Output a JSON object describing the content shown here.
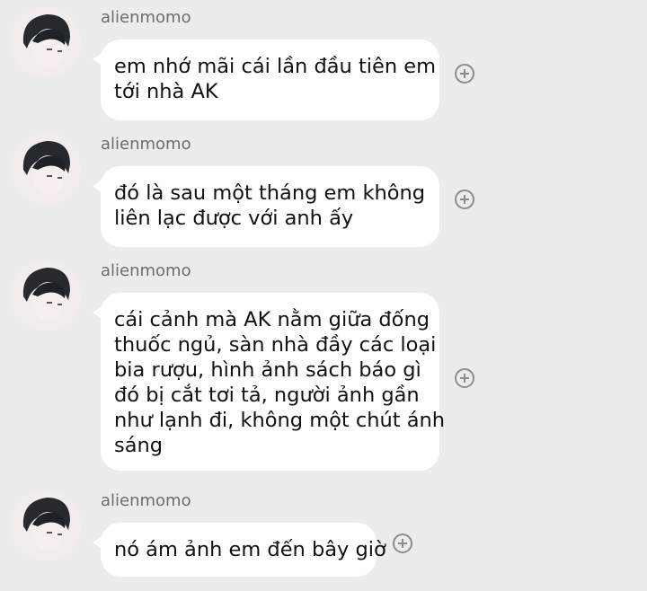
{
  "messages": [
    {
      "sender": "alienmomo",
      "avatar_icon": "avatar-photo",
      "lines": [
        "em nhớ mãi cái lần đầu tiên em",
        "tới nhà AK"
      ]
    },
    {
      "sender": "alienmomo",
      "avatar_icon": "avatar-photo",
      "lines": [
        "đó là sau một tháng em không",
        "liên lạc được với anh ấy"
      ]
    },
    {
      "sender": "alienmomo",
      "avatar_icon": "avatar-photo",
      "lines": [
        "cái cảnh mà AK nằm giữa đống",
        "thuốc ngủ, sàn nhà đầy các loại",
        "bia rượu, hình ảnh sách báo gì",
        "đó bị cắt tơi tả, người ảnh gần",
        "như lạnh đi, không một chút ánh",
        "sáng"
      ]
    },
    {
      "sender": "alienmomo",
      "avatar_icon": "avatar-photo",
      "lines": [
        "nó ám ảnh em đến bây giờ"
      ]
    }
  ],
  "react_icon": "add-reaction-icon",
  "colors": {
    "background": "#ececec",
    "bubble": "#ffffff",
    "sender": "#6d6d6d"
  }
}
